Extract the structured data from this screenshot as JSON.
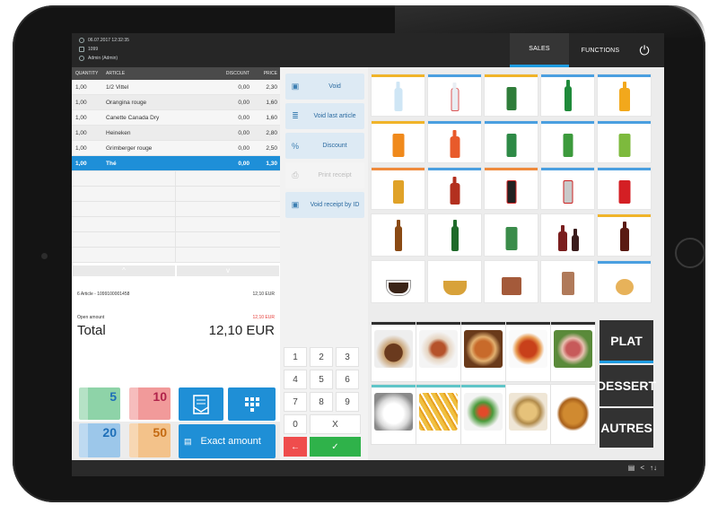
{
  "header": {
    "datetime": "06.07.2017 12:32:35",
    "register": "1099",
    "user": "Admin (Admin)",
    "tabs": [
      "SALES",
      "FUNCTIONS"
    ],
    "active_tab": "SALES"
  },
  "order": {
    "columns": {
      "quantity": "QUANTITY",
      "article": "ARTICLE",
      "discount": "DISCOUNT",
      "price": "PRICE"
    },
    "rows": [
      {
        "qty": "1,00",
        "article": "1/2 Vittel",
        "discount": "0,00",
        "price": "2,30"
      },
      {
        "qty": "1,00",
        "article": "Orangina rouge",
        "discount": "0,00",
        "price": "1,60"
      },
      {
        "qty": "1,00",
        "article": "Canette Canada Dry",
        "discount": "0,00",
        "price": "1,60"
      },
      {
        "qty": "1,00",
        "article": "Heineken",
        "discount": "0,00",
        "price": "2,80"
      },
      {
        "qty": "1,00",
        "article": "Grimberger rouge",
        "discount": "0,00",
        "price": "2,50"
      },
      {
        "qty": "1,00",
        "article": "Thé",
        "discount": "0,00",
        "price": "1,30"
      }
    ],
    "selected_row": 5,
    "scroll_up": "^",
    "scroll_down": "v",
    "summary_label": "6 Article - 1099100001458",
    "summary_value": "12,10 EUR",
    "open_amount_label": "Open amount",
    "open_amount_value": "12,10 EUR",
    "total_label": "Total",
    "total_value": "12,10 EUR"
  },
  "payment": {
    "bills": [
      "5",
      "10",
      "20",
      "50"
    ],
    "exact_amount": "Exact amount"
  },
  "functions": {
    "void": "Void",
    "void_last": "Void last article",
    "discount": "Discount",
    "print_receipt": "Print receipt",
    "void_receipt": "Void receipt by ID"
  },
  "numpad": {
    "keys": [
      "1",
      "2",
      "3",
      "4",
      "5",
      "6",
      "7",
      "8",
      "9",
      "0",
      "X"
    ],
    "back": "←",
    "ok": "✓"
  },
  "categories": [
    "PLAT",
    "DESSERT",
    "AUTRES"
  ],
  "colors": {
    "accent": "#1e8fd8",
    "topbar": "#262626",
    "ok_green": "#2fb24a",
    "back_red": "#ef4d4d"
  },
  "icons": {
    "power": "⏻",
    "bottom": [
      "printer-icon",
      "share-icon",
      "sort-arrows-icon"
    ]
  }
}
